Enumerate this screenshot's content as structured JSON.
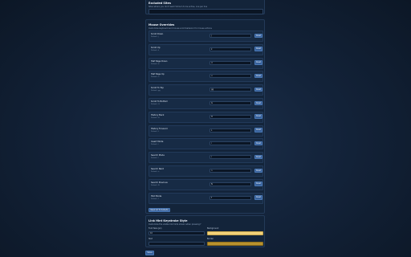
{
  "excluded_sites": {
    "title": "Excluded Sites",
    "description": "Sites where you don't want Vimium to be active, one per line",
    "value": ""
  },
  "mouse_overrides": {
    "title": "Mouse Overrides",
    "description": "Customize keyboard and mouse scroll behavior for mouse actions",
    "reset_label": "Reset",
    "items": [
      {
        "name": "Scroll Down",
        "default": "Default: j",
        "value": "j"
      },
      {
        "name": "Scroll Up",
        "default": "Default: k",
        "value": "k"
      },
      {
        "name": "Half Page Down",
        "default": "Default: d",
        "value": "d"
      },
      {
        "name": "Half Page Up",
        "default": "Default: u",
        "value": "u"
      },
      {
        "name": "Scroll To Top",
        "default": "Default: gg",
        "value": "gg"
      },
      {
        "name": "Scroll To Bottom",
        "default": "Default: G",
        "value": "G"
      },
      {
        "name": "History Back",
        "default": "Default: H",
        "value": "H"
      },
      {
        "name": "History Forward",
        "default": "Default: L",
        "value": "L"
      },
      {
        "name": "Insert Mode",
        "default": "Default: i",
        "value": "i"
      },
      {
        "name": "Search Mode",
        "default": "Default: /",
        "value": "/"
      },
      {
        "name": "Search Next",
        "default": "Default: n",
        "value": "n"
      },
      {
        "name": "Search Previous",
        "default": "Default: N",
        "value": "N"
      },
      {
        "name": "Hint Mode",
        "default": "Default: f",
        "value": "f"
      }
    ],
    "reset_all_label": "Reset All To Defaults"
  },
  "link_hint_style": {
    "title": "Link Hint Keystroke Style",
    "description": "Customize the visible link hints shown when pressing f",
    "fields": [
      {
        "label": "Font Size (px)",
        "value": "10"
      },
      {
        "label": "Background",
        "value": ""
      },
      {
        "label": "Text",
        "value": ""
      },
      {
        "label": "Border",
        "value": ""
      }
    ]
  },
  "save_label": "Save",
  "colors": {
    "accent": "#37609a",
    "background_swatch": "#f3d27a",
    "border_swatch": "#b8922e",
    "text_swatch": "#0a1524"
  }
}
